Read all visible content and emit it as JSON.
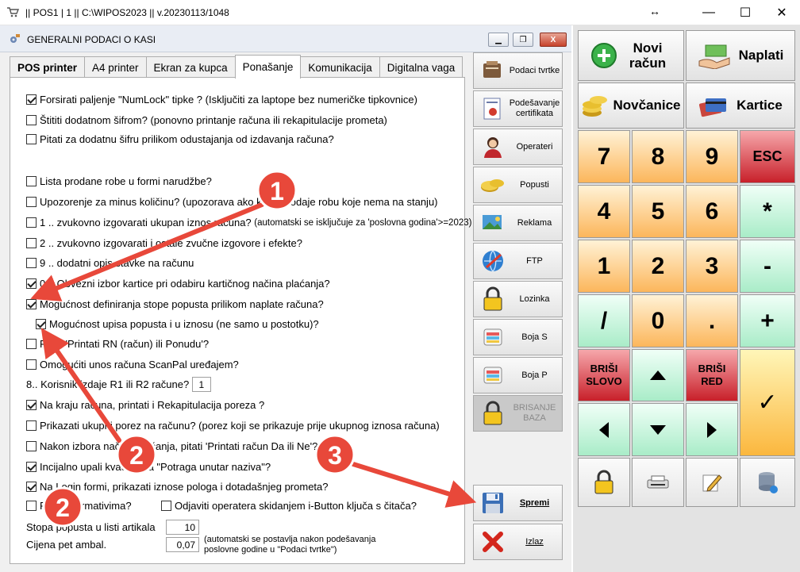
{
  "window": {
    "title": "|| POS1 | 1 || C:\\WIPOS2023 || v.20230113/1048",
    "resize_glyph": "↔",
    "min_glyph": "—",
    "max_glyph": "☐",
    "close_glyph": "✕"
  },
  "dialog": {
    "title": "GENERALNI PODACI O KASI",
    "close_glyph": "X",
    "tabs": [
      {
        "label": "POS printer"
      },
      {
        "label": "A4 printer"
      },
      {
        "label": "Ekran za kupca"
      },
      {
        "label": "Ponašanje"
      },
      {
        "label": "Komunikacija"
      },
      {
        "label": "Digitalna vaga"
      }
    ],
    "options": [
      {
        "label": "Forsirati paljenje \"NumLock\" tipke ? (Isključiti za laptope bez numeričke tipkovnice)",
        "checked": true
      },
      {
        "label": "Štititi dodatnom šifrom? (ponovno printanje računa ili rekapitulacije prometa)",
        "checked": false
      },
      {
        "label": "Pitati za dodatnu šifru prilikom odustajanja od izdavanja računa?",
        "checked": false
      },
      {
        "label": "Lista prodane robe u formi narudžbe?",
        "checked": false
      },
      {
        "label": "Upozorenje za minus količinu? (upozorava ako kasir prodaje robu koje nema na stanju)",
        "checked": false
      },
      {
        "label": "1 .. zvukovno izgovarati ukupan iznos računa?",
        "note": "(automatski se isključuje za 'poslovna godina'>=2023)",
        "checked": false
      },
      {
        "label": "2 .. zvukovno izgovarati i ostale zvučne izgovore i efekte?",
        "checked": false
      },
      {
        "label": "9 .. dodatni opis stavke na računu",
        "checked": false
      },
      {
        "label": "0 .. Obvezni izbor kartice pri odabiru kartičnog načina plaćanja?",
        "checked": true
      },
      {
        "label": "Mogućnost definiranja stope popusta prilikom naplate računa?",
        "checked": true
      },
      {
        "label": "Mogućnost upisa popusta i u iznosu (ne samo u postotku)?",
        "checked": true
      },
      {
        "label": "Pitati 'Printati RN (račun) ili Ponudu'?",
        "checked": false
      },
      {
        "label": "Omogućiti unos računa ScanPal uređajem?",
        "checked": false
      },
      {
        "label": "Na kraju računa, printati i Rekapitulacija poreza ?",
        "checked": true
      },
      {
        "label": "Prikazati ukupni porez na računu? (porez koji se prikazuje prije ukupnog iznosa računa)",
        "checked": false
      },
      {
        "label": "Nakon izbora načina plaćanja, pitati 'Printati račun Da ili Ne'?",
        "checked": false
      },
      {
        "label": "Incijalno upali kvačicu na \"Potraga unutar naziva\"?",
        "checked": true
      },
      {
        "label": "Na Login formi, prikazati iznose pologa i dotadašnjeg prometa?",
        "checked": true
      },
      {
        "label": "Rad s normativima?",
        "checked": false
      },
      {
        "label": "Odjaviti operatera skidanjem i-Button ključa s čitača?",
        "checked": false
      }
    ],
    "korisnik": {
      "label": "8.. Korisnik izdaje R1 ili R2 račune?",
      "value": "1"
    },
    "stopa": {
      "label": "Stopa popusta u listi artikala",
      "value": "10"
    },
    "cijena": {
      "label": "Cijena pet ambal.",
      "value": "0,07",
      "note_line1": "(automatski se postavlja nakon podešavanja",
      "note_line2": "poslovne godine u \"Podaci tvrtke\")"
    },
    "side_buttons": [
      {
        "label": "Podaci tvrtke",
        "icon": "company-icon"
      },
      {
        "label": "Podešavanje certifikata",
        "icon": "certificate-icon"
      },
      {
        "label": "Operateri",
        "icon": "operator-icon"
      },
      {
        "label": "Popusti",
        "icon": "coins-icon"
      },
      {
        "label": "Reklama",
        "icon": "advert-icon"
      },
      {
        "label": "FTP",
        "icon": "ftp-icon"
      },
      {
        "label": "Lozinka",
        "icon": "lock-icon"
      },
      {
        "label": "Boja S",
        "icon": "color-icon"
      },
      {
        "label": "Boja P",
        "icon": "color-icon"
      },
      {
        "label": "BRISANJE BAZA",
        "icon": "lock-icon"
      },
      {
        "label": "Spremi",
        "icon": "save-icon"
      },
      {
        "label": "Izlaz",
        "icon": "exit-icon"
      }
    ]
  },
  "pad": {
    "novi": "Novi račun",
    "naplati": "Naplati",
    "novcanice": "Novčanice",
    "kartice": "Kartice",
    "keys": [
      "7",
      "8",
      "9",
      "ESC",
      "4",
      "5",
      "6",
      "*",
      "1",
      "2",
      "3",
      "-",
      "/",
      "0",
      ".",
      "+"
    ],
    "brisi_slovo": "BRIŠI SLOVO",
    "brisi_red": "BRIŠI RED",
    "ok": "✓"
  },
  "annotations": [
    "1",
    "2",
    "3",
    "2"
  ],
  "colors": {
    "arrow": "#e8483a",
    "orange_key": "#fcb65b",
    "mint_key": "#a9ecc8",
    "red_key": "#c8202a"
  }
}
